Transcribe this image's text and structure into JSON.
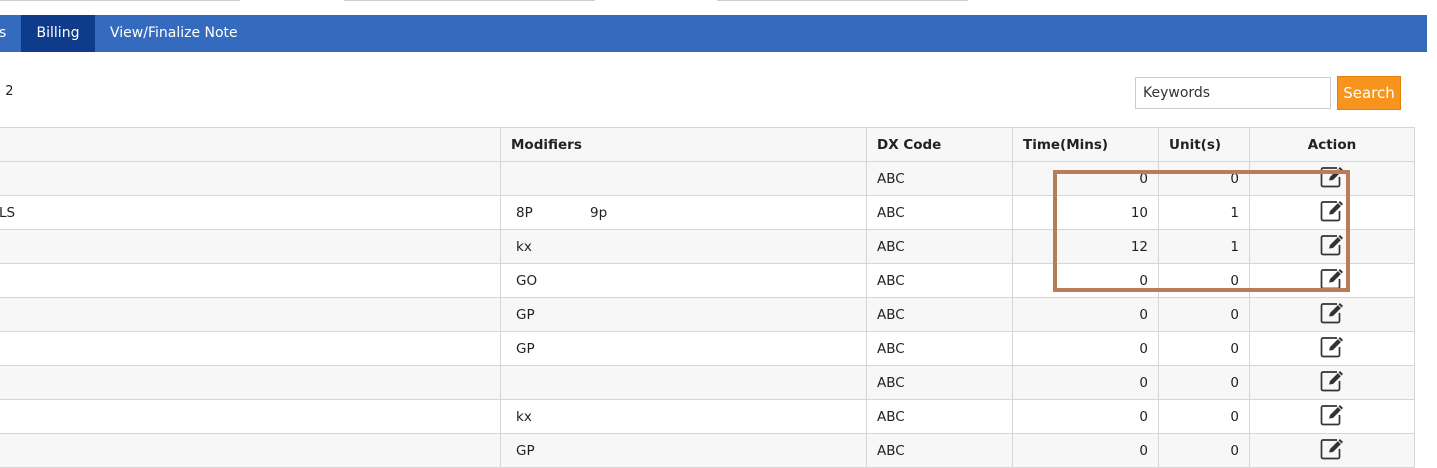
{
  "nav": {
    "tabs": [
      {
        "label": "s",
        "active": false
      },
      {
        "label": "Billing",
        "active": true
      },
      {
        "label": "View/Finalize Note",
        "active": false
      }
    ]
  },
  "record_count": {
    "label": "):",
    "value": "2"
  },
  "search": {
    "placeholder": "Keywords",
    "value": "",
    "button_label": "Search"
  },
  "table": {
    "headers": {
      "service": "",
      "modifiers": "Modifiers",
      "dx_code": "DX Code",
      "time": "Time(Mins)",
      "units": "Unit(s)",
      "action": "Action"
    },
    "rows": [
      {
        "service": "",
        "modifiers": [
          "",
          ""
        ],
        "dx_code": "ABC",
        "time": "0",
        "units": "0",
        "action_icon": "edit-icon"
      },
      {
        "service": "LS",
        "modifiers": [
          "8P",
          "9p"
        ],
        "dx_code": "ABC",
        "time": "10",
        "units": "1",
        "action_icon": "edit-icon"
      },
      {
        "service": "",
        "modifiers": [
          "kx",
          ""
        ],
        "dx_code": "ABC",
        "time": "12",
        "units": "1",
        "action_icon": "edit-icon"
      },
      {
        "service": "",
        "modifiers": [
          "GO",
          ""
        ],
        "dx_code": "ABC",
        "time": "0",
        "units": "0",
        "action_icon": "edit-icon"
      },
      {
        "service": "",
        "modifiers": [
          "GP",
          ""
        ],
        "dx_code": "ABC",
        "time": "0",
        "units": "0",
        "action_icon": "edit-icon"
      },
      {
        "service": "",
        "modifiers": [
          "GP",
          ""
        ],
        "dx_code": "ABC",
        "time": "0",
        "units": "0",
        "action_icon": "edit-icon"
      },
      {
        "service": "",
        "modifiers": [
          "",
          ""
        ],
        "dx_code": "ABC",
        "time": "0",
        "units": "0",
        "action_icon": "edit-icon"
      },
      {
        "service": "",
        "modifiers": [
          "kx",
          ""
        ],
        "dx_code": "ABC",
        "time": "0",
        "units": "0",
        "action_icon": "edit-icon"
      },
      {
        "service": "",
        "modifiers": [
          "GP",
          ""
        ],
        "dx_code": "ABC",
        "time": "0",
        "units": "0",
        "action_icon": "edit-icon"
      }
    ]
  },
  "colors": {
    "nav_bg": "#356bbf",
    "nav_active": "#0f3c8a",
    "search_button": "#f7941d",
    "highlight_box": "#b87c59"
  }
}
